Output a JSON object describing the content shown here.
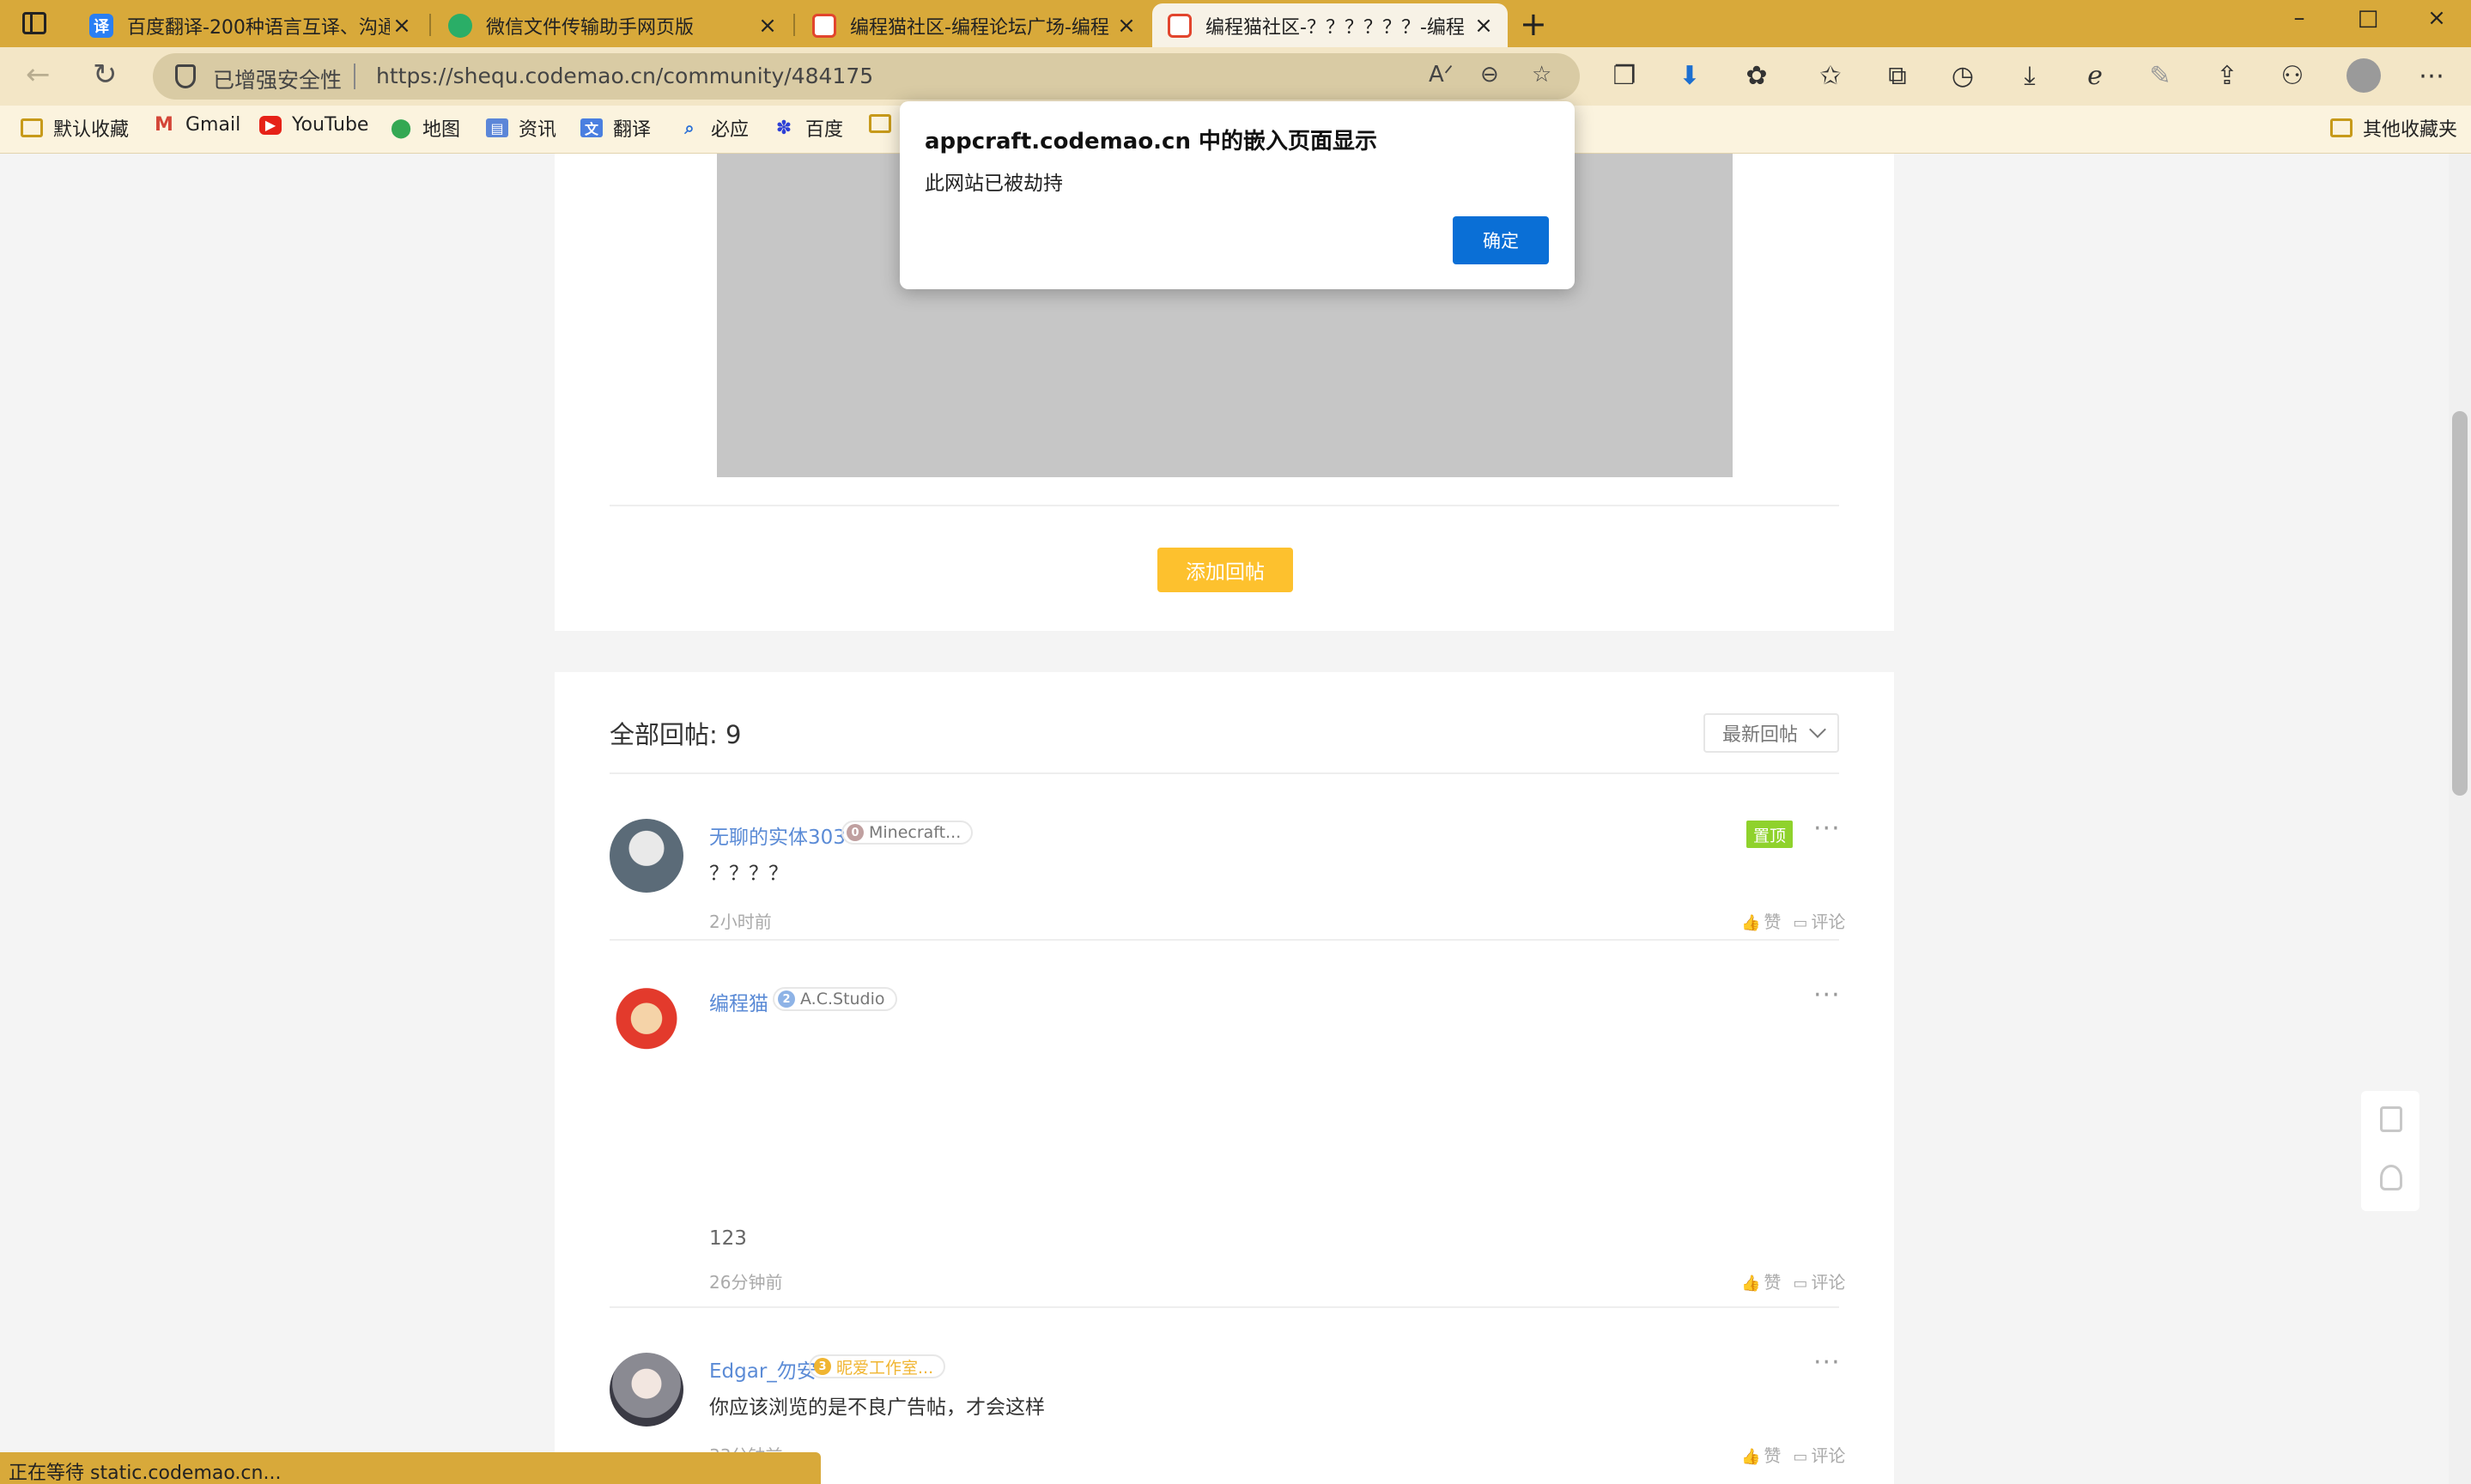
{
  "tabs": [
    {
      "label": "百度翻译-200种语言互译、沟通",
      "icon": "baidu-translate-icon",
      "icon_char": "译",
      "color": "#2a7ff3"
    },
    {
      "label": "微信文件传输助手网页版",
      "icon": "wechat-icon",
      "icon_char": "",
      "color": "#2aae67"
    },
    {
      "label": "编程猫社区-编程论坛广场-编程",
      "icon": "codemao-icon",
      "icon_char": "",
      "color": "#e2452d"
    },
    {
      "label": "编程猫社区-？？？？？？-编程",
      "icon": "codemao-icon",
      "icon_char": "",
      "color": "#e2452d"
    }
  ],
  "address": {
    "security": "已增强安全性",
    "url": "https://shequ.codemao.cn/community/484175"
  },
  "bookmarks": [
    {
      "label": "默认收藏",
      "icon": "folder-icon"
    },
    {
      "label": "Gmail",
      "icon": "gmail-icon"
    },
    {
      "label": "YouTube",
      "icon": "youtube-icon"
    },
    {
      "label": "地图",
      "icon": "map-pin-icon"
    },
    {
      "label": "资讯",
      "icon": "news-icon"
    },
    {
      "label": "翻译",
      "icon": "translate-icon"
    },
    {
      "label": "必应",
      "icon": "bing-search-icon"
    },
    {
      "label": "百度",
      "icon": "baidu-icon"
    },
    {
      "label": "",
      "icon": "folder-icon"
    },
    {
      "label": "其他收藏夹",
      "icon": "folder-icon"
    }
  ],
  "dialog": {
    "title": "appcraft.codemao.cn 中的嵌入页面显示",
    "message": "此网站已被劫持",
    "ok_label": "确定"
  },
  "page": {
    "add_reply_label": "添加回帖",
    "all_replies_label": "全部回帖: 9",
    "sort_label": "最新回帖",
    "like_label": "赞",
    "comment_label": "评论",
    "pinned_label": "置顶"
  },
  "posts": [
    {
      "user": "无聊的实体303",
      "level": "0",
      "level_color": "#c0a0a0",
      "badge": "Minecraft...",
      "text": "？？？？",
      "time": "2小时前",
      "pinned": true
    },
    {
      "user": "编程猫",
      "level": "2",
      "level_color": "#8eb3e6",
      "badge": "A.C.Studio",
      "text": "123",
      "time": "26分钟前",
      "pinned": false
    },
    {
      "user": "Edgar_勿安",
      "level": "3",
      "level_color": "#f0b531",
      "badge": "昵爱工作室...",
      "text": "你应该浏览的是不良广告帖，才会这样",
      "time": "33分钟前",
      "pinned": false
    }
  ],
  "status": "正在等待 static.codemao.cn..."
}
